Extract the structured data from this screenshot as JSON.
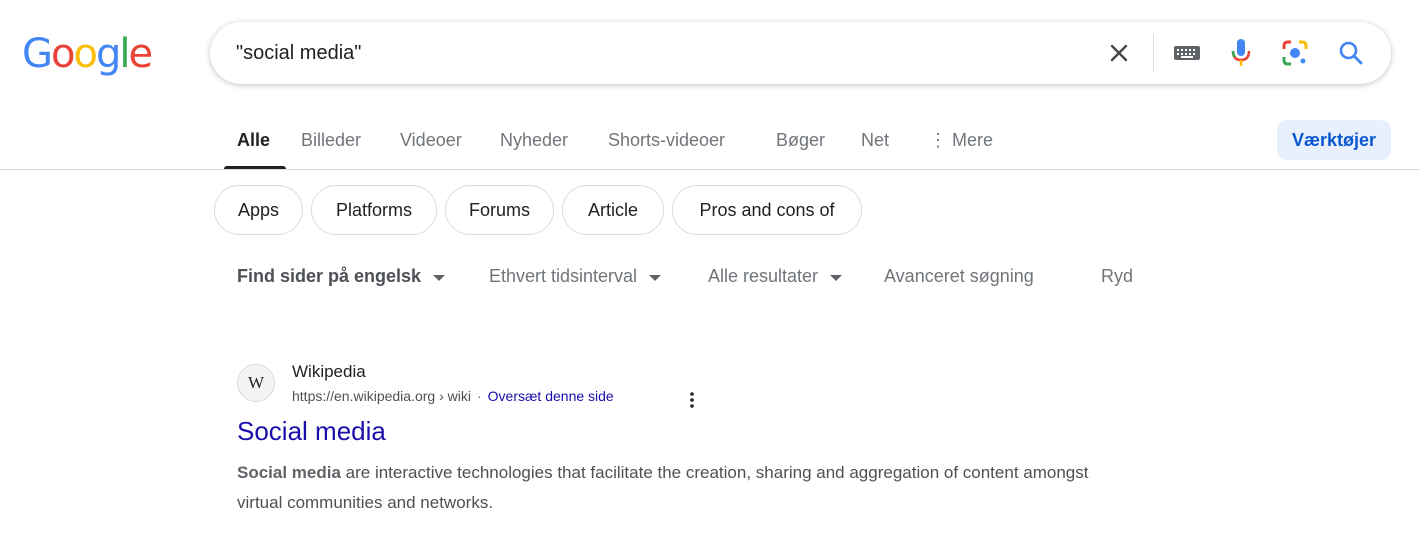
{
  "logo": {
    "letters": [
      "G",
      "o",
      "o",
      "g",
      "l",
      "e"
    ],
    "colors": [
      "#4285f4",
      "#ea4335",
      "#fbbc05",
      "#4285f4",
      "#34a853",
      "#ea4335"
    ]
  },
  "search": {
    "query": "\"social media\"",
    "icons": [
      "close-icon",
      "keyboard-icon",
      "microphone-icon",
      "lens-icon",
      "search-icon"
    ]
  },
  "tabs": {
    "items": [
      "Alle",
      "Billeder",
      "Videoer",
      "Nyheder",
      "Shorts-videoer",
      "Bøger",
      "Net"
    ],
    "more": "⋮ Mere",
    "tools": "Værktøjer"
  },
  "chips": [
    "Apps",
    "Platforms",
    "Forums",
    "Article",
    "Pros and cons of"
  ],
  "filters": {
    "language": "Find sider på engelsk",
    "time": "Ethvert tidsinterval",
    "results": "Alle resultater",
    "advanced": "Avanceret søgning",
    "clear": "Ryd"
  },
  "result": {
    "favicon": "W",
    "site": "Wikipedia",
    "url": "https://en.wikipedia.org › wiki",
    "separator": "·",
    "translate": "Oversæt denne side",
    "title": "Social media",
    "snippet_bold": "Social media",
    "snippet_rest": " are interactive technologies that facilitate the creation, sharing and aggregation of content amongst virtual communities and networks."
  },
  "colors": {
    "link": "#1a0dab",
    "accent": "#0b57d0",
    "tools_bg": "#e8f0fe"
  }
}
